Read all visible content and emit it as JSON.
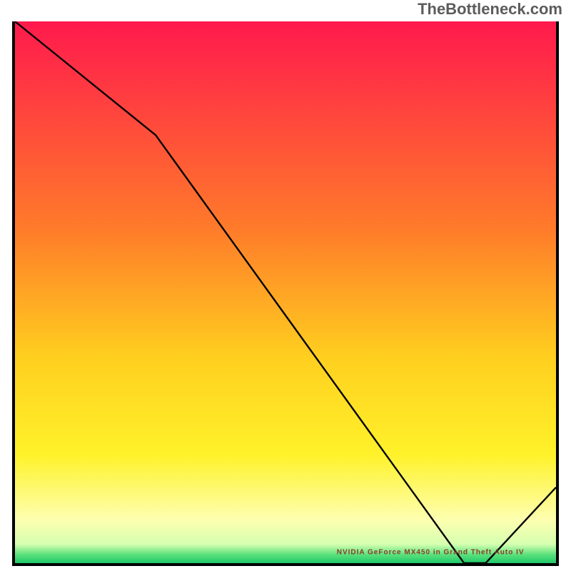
{
  "watermark": "TheBottleneck.com",
  "annotation_text": "NVIDIA GeForce MX450 in Grand Theft Auto IV",
  "chart_data": {
    "type": "line",
    "title": "",
    "xlabel": "",
    "ylabel": "",
    "xlim": [
      0,
      100
    ],
    "ylim": [
      0,
      100
    ],
    "series": [
      {
        "name": "bottleneck-curve",
        "x": [
          0,
          26,
          83,
          87,
          100
        ],
        "y": [
          100,
          79,
          0,
          0,
          14
        ]
      }
    ],
    "gradient_stops": [
      {
        "offset": 0.0,
        "color": "#ff1a4d"
      },
      {
        "offset": 0.38,
        "color": "#ff7a2a"
      },
      {
        "offset": 0.62,
        "color": "#ffcf1f"
      },
      {
        "offset": 0.8,
        "color": "#fff22a"
      },
      {
        "offset": 0.92,
        "color": "#fdffb0"
      },
      {
        "offset": 0.965,
        "color": "#d6ffb0"
      },
      {
        "offset": 0.985,
        "color": "#57e07a"
      },
      {
        "offset": 1.0,
        "color": "#1fc86a"
      }
    ],
    "annotation_pos_pct": {
      "x": 76,
      "y": 97.5
    }
  }
}
